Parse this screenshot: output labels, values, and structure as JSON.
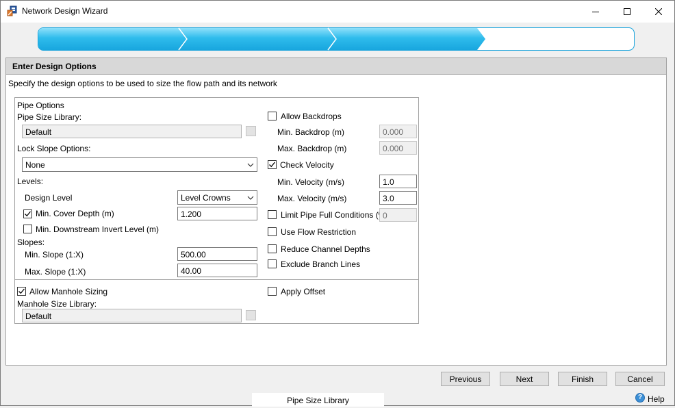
{
  "window": {
    "title": "Network Design Wizard",
    "controls": {
      "minimize": "minimize-icon",
      "maximize": "maximize-icon",
      "close": "close-icon"
    }
  },
  "progress": {
    "steps_total": 4,
    "steps_completed": 3,
    "accent": "#29b6e9"
  },
  "panel": {
    "heading": "Enter Design Options",
    "description": "Specify the design options to be used to size the flow path and its network"
  },
  "pipe": {
    "group_label": "Pipe Options",
    "size_library_label": "Pipe Size Library:",
    "size_library_value": "Default",
    "lock_slope_label": "Lock Slope Options:",
    "lock_slope_value": "None",
    "levels_label": "Levels:",
    "design_level_label": "Design Level",
    "design_level_value": "Level Crowns",
    "min_cover_label": "Min. Cover Depth (m)",
    "min_cover_checked": true,
    "min_cover_value": "1.200",
    "min_ds_invert_label": "Min. Downstream Invert Level (m)",
    "min_ds_invert_checked": false,
    "slopes_label": "Slopes:",
    "min_slope_label": "Min. Slope (1:X)",
    "min_slope_value": "500.00",
    "max_slope_label": "Max. Slope (1:X)",
    "max_slope_value": "40.00"
  },
  "backdrops": {
    "allow_label": "Allow Backdrops",
    "allow_checked": false,
    "min_label": "Min. Backdrop (m)",
    "min_value": "0.000",
    "max_label": "Max. Backdrop (m)",
    "max_value": "0.000"
  },
  "velocity": {
    "check_label": "Check Velocity",
    "check_checked": true,
    "min_label": "Min. Velocity (m/s)",
    "min_value": "1.0",
    "max_label": "Max. Velocity (m/s)",
    "max_value": "3.0"
  },
  "options": {
    "limit_full_label": "Limit Pipe Full Conditions (%)",
    "limit_full_checked": false,
    "limit_full_value": "0",
    "flow_restriction_label": "Use Flow Restriction",
    "flow_restriction_checked": false,
    "reduce_channel_label": "Reduce Channel Depths",
    "reduce_channel_checked": false,
    "exclude_branch_label": "Exclude Branch Lines",
    "exclude_branch_checked": false
  },
  "manhole": {
    "allow_sizing_label": "Allow Manhole Sizing",
    "allow_sizing_checked": true,
    "library_label": "Manhole Size Library:",
    "library_value": "Default",
    "apply_offset_label": "Apply Offset",
    "apply_offset_checked": false
  },
  "buttons": {
    "previous": "Previous",
    "next": "Next",
    "finish": "Finish",
    "cancel": "Cancel"
  },
  "footer": {
    "status": "Pipe Size Library",
    "help": "Help"
  }
}
